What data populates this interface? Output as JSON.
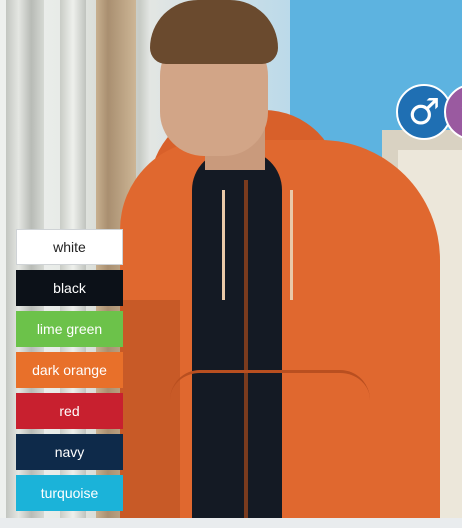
{
  "product_colors": [
    {
      "label": "white",
      "hex": "#ffffff",
      "text_color": "#222222"
    },
    {
      "label": "black",
      "hex": "#0c1118",
      "text_color": "#ffffff"
    },
    {
      "label": "lime green",
      "hex": "#6cc24a",
      "text_color": "#ffffff"
    },
    {
      "label": "dark orange",
      "hex": "#e8702a",
      "text_color": "#ffffff"
    },
    {
      "label": "red",
      "hex": "#c8202f",
      "text_color": "#ffffff"
    },
    {
      "label": "navy",
      "hex": "#0e2a4a",
      "text_color": "#ffffff"
    },
    {
      "label": "turquoise",
      "hex": "#1bb3d9",
      "text_color": "#ffffff"
    }
  ],
  "gender_badges": [
    {
      "name": "male-symbol-icon",
      "glyph": "♂",
      "color": "#1f6fb3"
    },
    {
      "name": "female-symbol-icon",
      "glyph": "♀",
      "color": "#9a5aa0"
    }
  ]
}
